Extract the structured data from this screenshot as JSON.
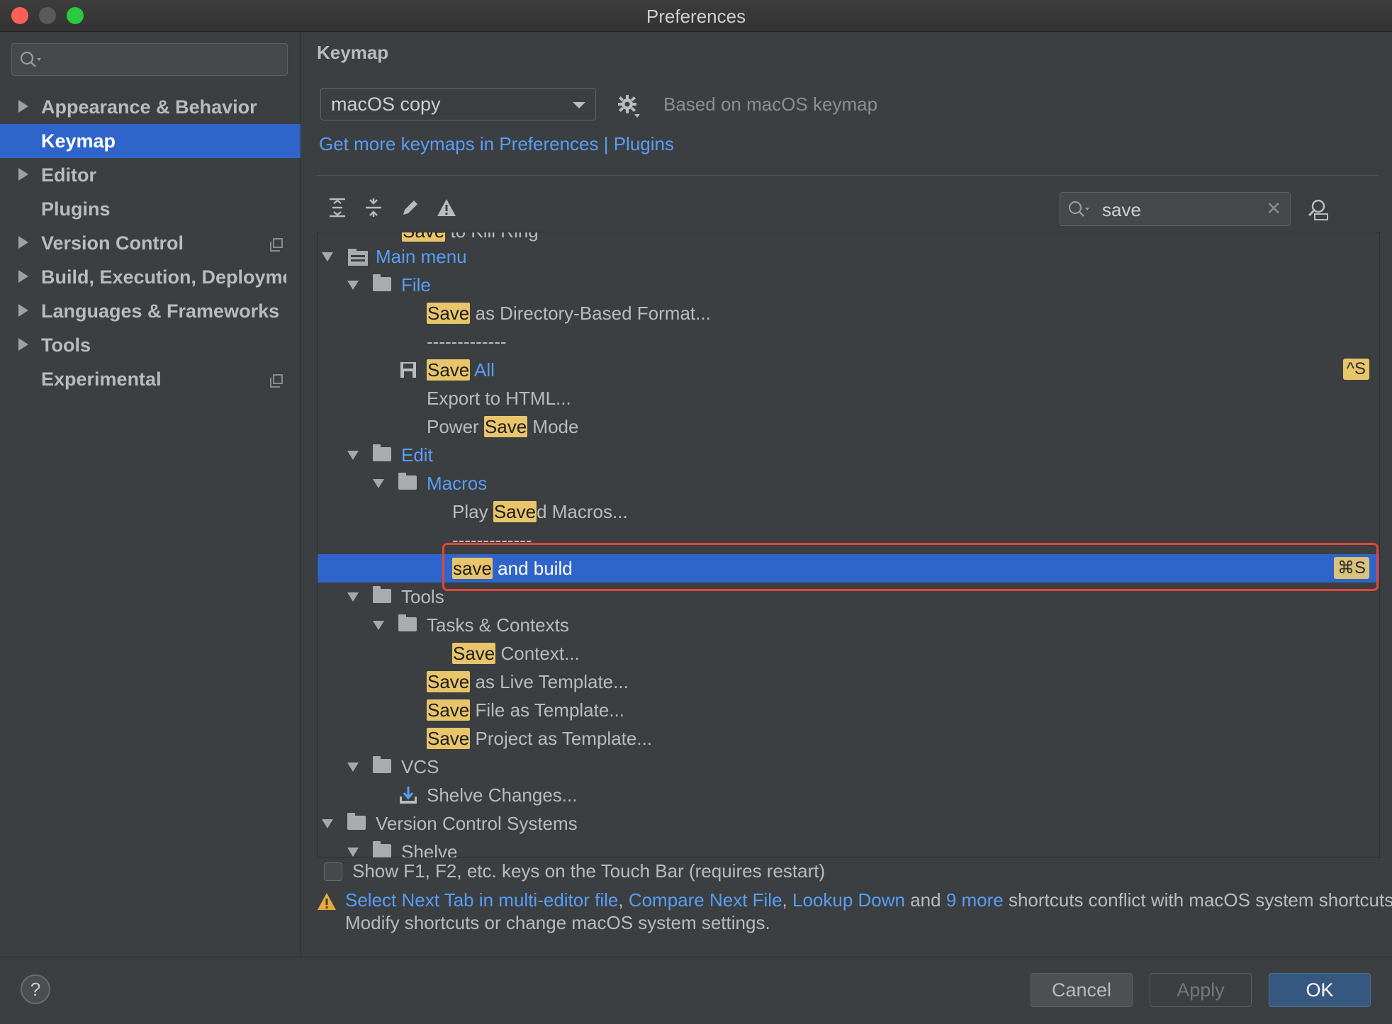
{
  "window": {
    "title": "Preferences"
  },
  "sidebar": {
    "search_placeholder": "",
    "items": [
      {
        "label": "Appearance & Behavior",
        "expandable": true
      },
      {
        "label": "Keymap",
        "selected": true
      },
      {
        "label": "Editor",
        "expandable": true
      },
      {
        "label": "Plugins"
      },
      {
        "label": "Version Control",
        "expandable": true,
        "project_icon": true
      },
      {
        "label": "Build, Execution, Deployment",
        "expandable": true
      },
      {
        "label": "Languages & Frameworks",
        "expandable": true
      },
      {
        "label": "Tools",
        "expandable": true
      },
      {
        "label": "Experimental",
        "project_icon": true
      }
    ]
  },
  "keymap": {
    "heading": "Keymap",
    "scheme": "macOS copy",
    "based_on": "Based on macOS keymap",
    "more_link": "Get more keymaps in Preferences | Plugins",
    "filter_value": "save"
  },
  "tree": {
    "partial_top": {
      "hl": "Save",
      "rest": " to Kill Ring"
    },
    "main_menu": "Main menu",
    "file": "File",
    "save_dir_hl": "Save",
    "save_dir_rest": " as Directory-Based Format...",
    "separator1": "-------------",
    "save_all_hl": "Save",
    "save_all_rest": " All",
    "save_all_shortcut": "^S",
    "export_html": "Export to HTML...",
    "power_pre": "Power ",
    "power_hl": "Save",
    "power_post": " Mode",
    "edit": "Edit",
    "macros": "Macros",
    "play_pre": "Play ",
    "play_hl": "Save",
    "play_post": "d Macros...",
    "separator2": "-------------",
    "save_build_hl": "save",
    "save_build_rest": " and build",
    "save_build_shortcut": "⌘S",
    "tools": "Tools",
    "tasks": "Tasks & Contexts",
    "ctx_hl": "Save",
    "ctx_rest": " Context...",
    "live_hl": "Save",
    "live_rest": " as Live Template...",
    "filetpl_hl": "Save",
    "filetpl_rest": " File as Template...",
    "projtpl_hl": "Save",
    "projtpl_rest": " Project as Template...",
    "vcs": "VCS",
    "shelve_changes": "Shelve Changes...",
    "vcs_systems": "Version Control Systems",
    "shelve": "Shelve"
  },
  "touchbar_label": "Show F1, F2, etc. keys on the Touch Bar (requires restart)",
  "warning": {
    "l1": "Select Next Tab in multi-editor file",
    "c1": ", ",
    "l2": "Compare Next File",
    "c2": ", ",
    "l3": "Lookup Down",
    "c3": " and ",
    "l4": "9 more",
    "tail": " shortcuts conflict with macOS system shortcuts.",
    "line2": "Modify shortcuts or change macOS system settings."
  },
  "buttons": {
    "help": "?",
    "cancel": "Cancel",
    "apply": "Apply",
    "ok": "OK"
  }
}
